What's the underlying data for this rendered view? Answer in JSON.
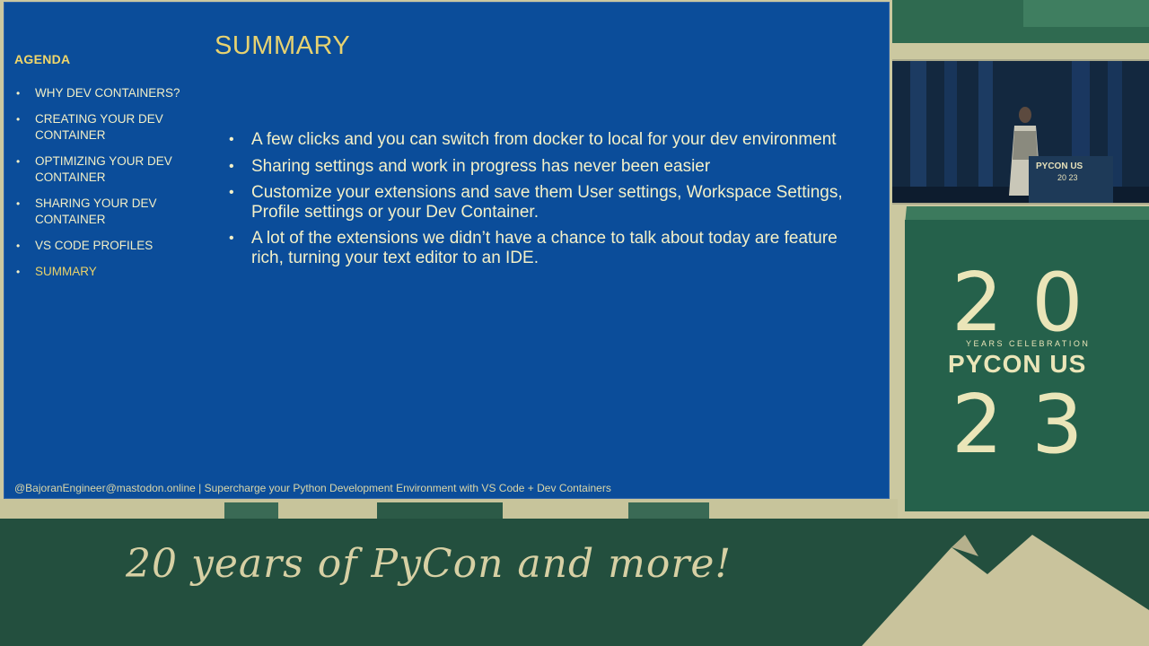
{
  "slide": {
    "title": "SUMMARY",
    "agenda": {
      "heading": "AGENDA",
      "items": [
        {
          "label": "WHY DEV CONTAINERS?"
        },
        {
          "label": "CREATING YOUR DEV CONTAINER"
        },
        {
          "label": "OPTIMIZING YOUR DEV CONTAINER"
        },
        {
          "label": "SHARING YOUR DEV CONTAINER"
        },
        {
          "label": "VS CODE PROFILES"
        },
        {
          "label": "SUMMARY"
        }
      ],
      "active_item": "SUMMARY"
    },
    "bullet_glyph": "•",
    "points": [
      "A few clicks and you can switch from docker to local for your dev environment",
      "Sharing settings and work in progress has never been easier",
      "Customize your extensions and save them User settings, Workspace Settings, Profile settings or your Dev Container.",
      "A lot of the extensions we didn’t have a chance to talk about today are feature rich, turning your text editor to an IDE."
    ],
    "footer": "@BajoranEngineer@mastodon.online | Supercharge your Python Development Environment with VS Code + Dev Containers"
  },
  "camera": {
    "podium_logo": "PYCON US",
    "podium_years": "20 23"
  },
  "event_logo": {
    "top_number": "20",
    "subtitle": "YEARS CELEBRATION",
    "name": "PYCON US",
    "bottom_number": "23"
  },
  "tagline": "20 years of PyCon and more!",
  "colors": {
    "slide_bg": "#0b4d9a",
    "accent_yellow": "#e7d270",
    "bottom_green": "#234f3e",
    "panel_green": "#25614b",
    "cream": "#cbc8a0"
  }
}
